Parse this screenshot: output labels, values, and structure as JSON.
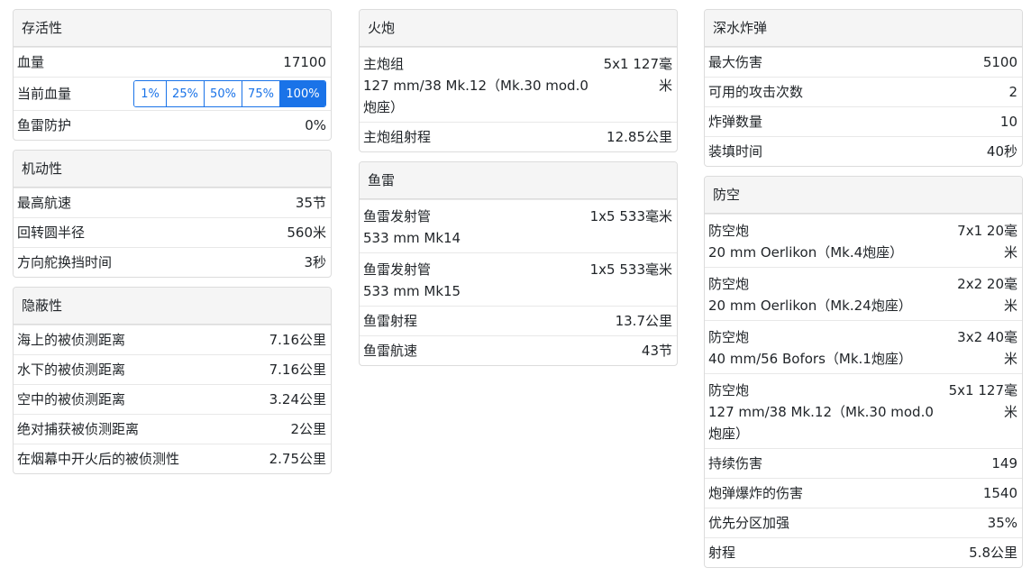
{
  "survivability": {
    "title": "存活性",
    "hp_label": "血量",
    "hp_value": "17100",
    "current_hp_label": "当前血量",
    "hp_buttons": [
      "1%",
      "25%",
      "50%",
      "75%",
      "100%"
    ],
    "hp_selected": "100%",
    "torpedo_protection_label": "鱼雷防护",
    "torpedo_protection_value": "0%"
  },
  "maneuverability": {
    "title": "机动性",
    "rows": [
      {
        "label": "最高航速",
        "value": "35节"
      },
      {
        "label": "回转圆半径",
        "value": "560米"
      },
      {
        "label": "方向舵换挡时间",
        "value": "3秒"
      }
    ]
  },
  "concealment": {
    "title": "隐蔽性",
    "rows": [
      {
        "label": "海上的被侦测距离",
        "value": "7.16公里"
      },
      {
        "label": "水下的被侦测距离",
        "value": "7.16公里"
      },
      {
        "label": "空中的被侦测距离",
        "value": "3.24公里"
      },
      {
        "label": "绝对捕获被侦测距离",
        "value": "2公里"
      },
      {
        "label": "在烟幕中开火后的被侦测性",
        "value": "2.75公里"
      }
    ]
  },
  "artillery": {
    "title": "火炮",
    "main_battery_label": "主炮组",
    "main_battery_sub": "127 mm/38 Mk.12（Mk.30 mod.0炮座）",
    "main_battery_value": "5x1 127毫米",
    "range_label": "主炮组射程",
    "range_value": "12.85公里"
  },
  "torpedoes": {
    "title": "鱼雷",
    "launchers": [
      {
        "label": "鱼雷发射管",
        "sub": "533 mm Mk14",
        "value": "1x5 533毫米"
      },
      {
        "label": "鱼雷发射管",
        "sub": "533 mm Mk15",
        "value": "1x5 533毫米"
      }
    ],
    "range_label": "鱼雷射程",
    "range_value": "13.7公里",
    "speed_label": "鱼雷航速",
    "speed_value": "43节"
  },
  "depth_charges": {
    "title": "深水炸弹",
    "rows": [
      {
        "label": "最大伤害",
        "value": "5100"
      },
      {
        "label": "可用的攻击次数",
        "value": "2"
      },
      {
        "label": "炸弹数量",
        "value": "10"
      },
      {
        "label": "装填时间",
        "value": "40秒"
      }
    ]
  },
  "aa": {
    "title": "防空",
    "guns": [
      {
        "label": "防空炮",
        "sub": "20 mm Oerlikon（Mk.4炮座）",
        "value": "7x1 20毫米"
      },
      {
        "label": "防空炮",
        "sub": "20 mm Oerlikon（Mk.24炮座）",
        "value": "2x2 20毫米"
      },
      {
        "label": "防空炮",
        "sub": "40 mm/56 Bofors（Mk.1炮座）",
        "value": "3x2 40毫米"
      },
      {
        "label": "防空炮",
        "sub": "127 mm/38 Mk.12（Mk.30 mod.0炮座）",
        "value": "5x1 127毫米"
      }
    ],
    "rows": [
      {
        "label": "持续伤害",
        "value": "149"
      },
      {
        "label": "炮弹爆炸的伤害",
        "value": "1540"
      },
      {
        "label": "优先分区加强",
        "value": "35%"
      },
      {
        "label": "射程",
        "value": "5.8公里"
      }
    ]
  }
}
